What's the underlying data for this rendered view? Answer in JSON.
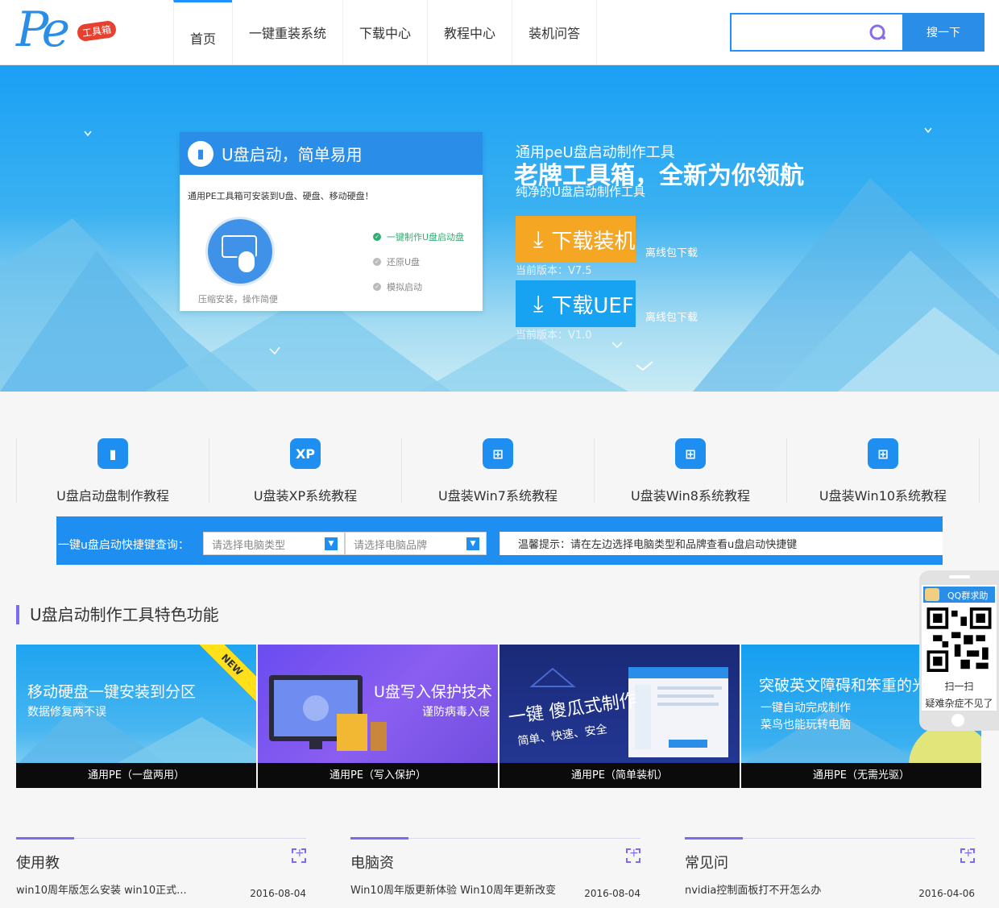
{
  "header": {
    "logo_text": "Pe",
    "logo_tag": "工具箱",
    "nav": [
      {
        "label": "首页"
      },
      {
        "label": "一键重装系统"
      },
      {
        "label": "下载中心"
      },
      {
        "label": "教程中心"
      },
      {
        "label": "装机问答"
      }
    ],
    "search": {
      "placeholder": "",
      "button_label": "搜一下"
    }
  },
  "banner": {
    "card": {
      "title": "U盘启动，简单易用",
      "desc": "通用PE工具箱可安装到U盘、硬盘、移动硬盘！",
      "caption": "压缩安装，操作简便",
      "options": [
        {
          "label": "一键制作U盘启动盘",
          "active": true
        },
        {
          "label": "还原U盘",
          "active": false
        },
        {
          "label": "模拟启动",
          "active": false
        }
      ]
    },
    "subtitle": "通用peU盘启动制作工具",
    "title": "老牌工具箱，全新为你领航",
    "subtitle2": "纯净的U盘启动制作工具",
    "download1": {
      "label": "下载装机",
      "version": "当前版本：V7.5",
      "offline": "离线包下载"
    },
    "download2": {
      "label": "下载UEFI",
      "version": "当前版本：V1.0",
      "offline": "离线包下载"
    }
  },
  "tutorials": [
    {
      "label": "U盘启动盘制作教程",
      "icon": "usb-icon"
    },
    {
      "label": "U盘装XP系统教程",
      "icon": "xp-icon",
      "icon_text": "XP"
    },
    {
      "label": "U盘装Win7系统教程",
      "icon": "windows7-icon"
    },
    {
      "label": "U盘装Win8系统教程",
      "icon": "windows8-icon"
    },
    {
      "label": "U盘装Win10系统教程",
      "icon": "windows10-icon"
    }
  ],
  "query": {
    "label": "一键u盘启动快捷键查询：",
    "select_type": "请选择电脑类型",
    "select_brand": "请选择电脑品牌",
    "tip": "温馨提示：请在左边选择电脑类型和品牌查看u盘启动快捷键"
  },
  "qq_widget": {
    "header": "QQ群求助",
    "scan": "扫一扫",
    "help": "疑难杂症不见了"
  },
  "features": {
    "title": "U盘启动制作工具特色功能",
    "items": [
      {
        "headline": "移动硬盘一键安装到分区",
        "sub": "数据修复两不误",
        "caption": "通用PE（一盘两用）",
        "ribbon": "NEW"
      },
      {
        "headline": "U盘写入保护技术",
        "sub": "谨防病毒入侵",
        "caption": "通用PE（写入保护）"
      },
      {
        "headline": "一键 傻瓜式制作",
        "sub": "简单、快速、安全",
        "caption": "通用PE（简单装机）"
      },
      {
        "headline": "突破英文障碍和笨重的光",
        "sub": "一键自动完成制作",
        "sub2": "菜鸟也能玩转电脑",
        "caption": "通用PE（无需光驱）"
      }
    ]
  },
  "news": [
    {
      "title": "使用教",
      "item": "win10周年版怎么安装 win10正式...",
      "date": "2016-08-04"
    },
    {
      "title": "电脑资",
      "item": "Win10周年版更新体验 Win10周年更新改变",
      "date": "2016-08-04"
    },
    {
      "title": "常见问",
      "item": "nvidia控制面板打不开怎么办",
      "date": "2016-04-06"
    }
  ],
  "colors": {
    "accent": "#1e8ff0",
    "orange": "#f5a623",
    "purple": "#7a6cf0"
  }
}
